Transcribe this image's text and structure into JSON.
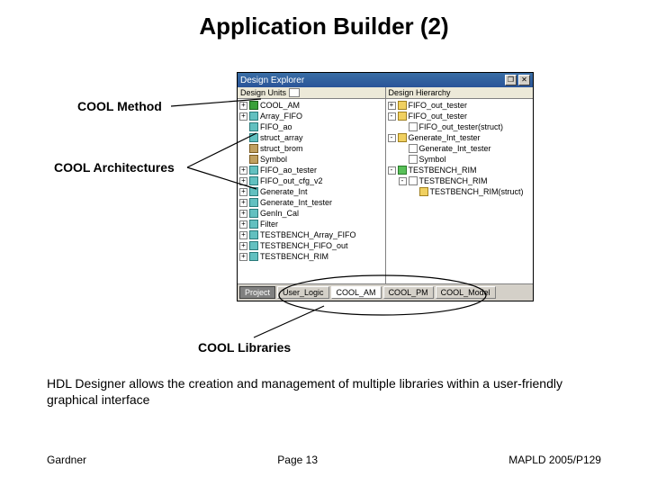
{
  "title": "Application Builder (2)",
  "annotations": {
    "method": "COOL Method",
    "architectures": "COOL Architectures",
    "libraries": "COOL Libraries"
  },
  "description": "HDL Designer allows the creation and management of multiple libraries within a user-friendly graphical interface",
  "footer": {
    "left": "Gardner",
    "center": "Page 13",
    "right": "MAPLD 2005/P129"
  },
  "window": {
    "title": "Design Explorer",
    "left_header": "Design Units",
    "right_header": "Design Hierarchy",
    "left_items": [
      {
        "toggle": "+",
        "icon": "method",
        "label": "COOL_AM",
        "indent": 0
      },
      {
        "toggle": "+",
        "icon": "arch",
        "label": "Array_FIFO",
        "indent": 0
      },
      {
        "toggle": "",
        "icon": "arch",
        "label": "FIFO_ao",
        "indent": 0
      },
      {
        "toggle": "",
        "icon": "arch",
        "label": "struct_array",
        "indent": 0
      },
      {
        "toggle": "",
        "icon": "arch2",
        "label": "struct_brom",
        "indent": 0
      },
      {
        "toggle": "",
        "icon": "arch2",
        "label": "Symbol",
        "indent": 0
      },
      {
        "toggle": "+",
        "icon": "arch",
        "label": "FIFO_ao_tester",
        "indent": 0
      },
      {
        "toggle": "+",
        "icon": "arch",
        "label": "FIFO_out_cfg_v2",
        "indent": 0
      },
      {
        "toggle": "+",
        "icon": "arch",
        "label": "Generate_Int",
        "indent": 0
      },
      {
        "toggle": "+",
        "icon": "arch",
        "label": "Generate_Int_tester",
        "indent": 0
      },
      {
        "toggle": "+",
        "icon": "arch",
        "label": "GenIn_Cal",
        "indent": 0
      },
      {
        "toggle": "+",
        "icon": "arch",
        "label": "Filter",
        "indent": 0
      },
      {
        "toggle": "+",
        "icon": "arch",
        "label": "TESTBENCH_Array_FIFO",
        "indent": 0
      },
      {
        "toggle": "+",
        "icon": "arch",
        "label": "TESTBENCH_FIFO_out",
        "indent": 0
      },
      {
        "toggle": "+",
        "icon": "arch",
        "label": "TESTBENCH_RIM",
        "indent": 0
      }
    ],
    "right_items": [
      {
        "toggle": "+",
        "icon": "ent",
        "label": "FIFO_out_tester",
        "indent": 0
      },
      {
        "toggle": "-",
        "icon": "ent",
        "label": "FIFO_out_tester",
        "indent": 0
      },
      {
        "toggle": "",
        "icon": "folder",
        "label": "FIFO_out_tester(struct)",
        "indent": 1
      },
      {
        "toggle": "-",
        "icon": "ent",
        "label": "Generate_Int_tester",
        "indent": 0
      },
      {
        "toggle": "",
        "icon": "folder",
        "label": "Generate_Int_tester",
        "indent": 1
      },
      {
        "toggle": "",
        "icon": "folder",
        "label": "Symbol",
        "indent": 1
      },
      {
        "toggle": "-",
        "icon": "tb",
        "label": "TESTBENCH_RIM",
        "indent": 0
      },
      {
        "toggle": "-",
        "icon": "folder",
        "label": "TESTBENCH_RIM",
        "indent": 1
      },
      {
        "toggle": "",
        "icon": "ent",
        "label": "TESTBENCH_RIM(struct)",
        "indent": 2
      }
    ],
    "tabs": [
      {
        "label": "Project",
        "style": "dark"
      },
      {
        "label": "User_Logic",
        "style": "normal"
      },
      {
        "label": "COOL_AM",
        "style": "active"
      },
      {
        "label": "COOL_PM",
        "style": "normal"
      },
      {
        "label": "COOL_Model",
        "style": "normal"
      }
    ],
    "buttons": {
      "restore": "❐",
      "close": "✕"
    }
  }
}
